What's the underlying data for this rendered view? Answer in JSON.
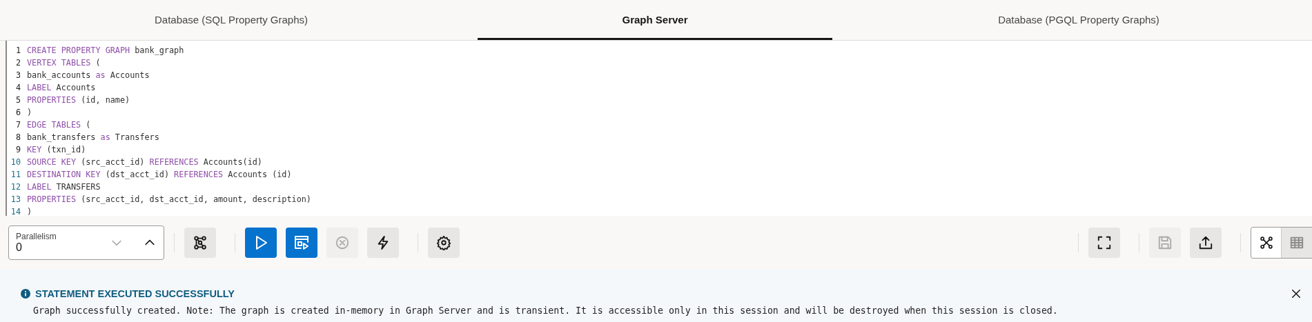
{
  "tabs": [
    {
      "label": "Database (SQL Property Graphs)",
      "selected": false
    },
    {
      "label": "Graph Server",
      "selected": true
    },
    {
      "label": "Database (PGQL Property Graphs)",
      "selected": false
    }
  ],
  "editor": {
    "lines": [
      {
        "number": "1",
        "tokens": [
          {
            "text": "CREATE PROPERTY GRAPH",
            "kind": "keyword"
          },
          {
            "text": " bank_graph",
            "kind": "plain"
          }
        ]
      },
      {
        "number": "2",
        "tokens": [
          {
            "text": "VERTEX TABLES",
            "kind": "keyword"
          },
          {
            "text": " (",
            "kind": "plain"
          }
        ]
      },
      {
        "number": "3",
        "tokens": [
          {
            "text": "bank_accounts ",
            "kind": "plain"
          },
          {
            "text": "as",
            "kind": "keyword"
          },
          {
            "text": " Accounts",
            "kind": "plain"
          }
        ]
      },
      {
        "number": "4",
        "tokens": [
          {
            "text": "LABEL",
            "kind": "keyword"
          },
          {
            "text": " Accounts",
            "kind": "plain"
          }
        ]
      },
      {
        "number": "5",
        "tokens": [
          {
            "text": "PROPERTIES",
            "kind": "keyword"
          },
          {
            "text": " (id, name)",
            "kind": "plain"
          }
        ]
      },
      {
        "number": "6",
        "tokens": [
          {
            "text": ")",
            "kind": "plain"
          }
        ]
      },
      {
        "number": "7",
        "tokens": [
          {
            "text": "EDGE TABLES",
            "kind": "keyword"
          },
          {
            "text": " (",
            "kind": "plain"
          }
        ]
      },
      {
        "number": "8",
        "tokens": [
          {
            "text": "bank_transfers ",
            "kind": "plain"
          },
          {
            "text": "as",
            "kind": "keyword"
          },
          {
            "text": " Transfers",
            "kind": "plain"
          }
        ]
      },
      {
        "number": "9",
        "tokens": [
          {
            "text": "KEY",
            "kind": "keyword"
          },
          {
            "text": " (txn_id)",
            "kind": "plain"
          }
        ]
      },
      {
        "number": "10",
        "tokens": [
          {
            "text": "SOURCE KEY",
            "kind": "keyword"
          },
          {
            "text": " (src_acct_id) ",
            "kind": "plain"
          },
          {
            "text": "REFERENCES",
            "kind": "keyword"
          },
          {
            "text": " Accounts(id)",
            "kind": "plain"
          }
        ]
      },
      {
        "number": "11",
        "tokens": [
          {
            "text": "DESTINATION KEY",
            "kind": "keyword"
          },
          {
            "text": " (dst_acct_id) ",
            "kind": "plain"
          },
          {
            "text": "REFERENCES",
            "kind": "keyword"
          },
          {
            "text": " Accounts (id)",
            "kind": "plain"
          }
        ]
      },
      {
        "number": "12",
        "tokens": [
          {
            "text": "LABEL",
            "kind": "keyword"
          },
          {
            "text": " TRANSFERS",
            "kind": "plain"
          }
        ]
      },
      {
        "number": "13",
        "tokens": [
          {
            "text": "PROPERTIES",
            "kind": "keyword"
          },
          {
            "text": " (src_acct_id, dst_acct_id, amount, description)",
            "kind": "plain"
          }
        ]
      },
      {
        "number": "14",
        "tokens": [
          {
            "text": ")",
            "kind": "plain"
          }
        ]
      }
    ]
  },
  "toolbar": {
    "parallelism": {
      "label": "Parallelism",
      "value": "0",
      "decrement_disabled": true,
      "increment_disabled": false
    },
    "left_groups": [
      [
        {
          "kind": "graph",
          "primary": false,
          "disabled": false
        }
      ],
      [
        {
          "kind": "run",
          "primary": true,
          "disabled": false
        },
        {
          "kind": "run-script",
          "primary": true,
          "disabled": false
        },
        {
          "kind": "cancel",
          "primary": false,
          "disabled": true
        },
        {
          "kind": "bolt",
          "primary": false,
          "disabled": false
        }
      ],
      [
        {
          "kind": "settings",
          "primary": false,
          "disabled": false
        }
      ]
    ],
    "right_groups": [
      [
        {
          "kind": "fullscreen",
          "primary": false,
          "disabled": false
        }
      ],
      [
        {
          "kind": "save",
          "primary": false,
          "disabled": true
        },
        {
          "kind": "upload",
          "primary": false,
          "disabled": false
        }
      ]
    ],
    "view_toggle": [
      {
        "kind": "graph-view",
        "selected": true
      },
      {
        "kind": "table-view",
        "selected": false
      }
    ]
  },
  "message": {
    "kind": "info",
    "title": "STATEMENT EXECUTED SUCCESSFULLY",
    "text": "Graph successfully created. Note: The graph is created in-memory in Graph Server and is transient. It is accessible only in this session and will be destroyed when this session is closed.",
    "closable": true
  }
}
